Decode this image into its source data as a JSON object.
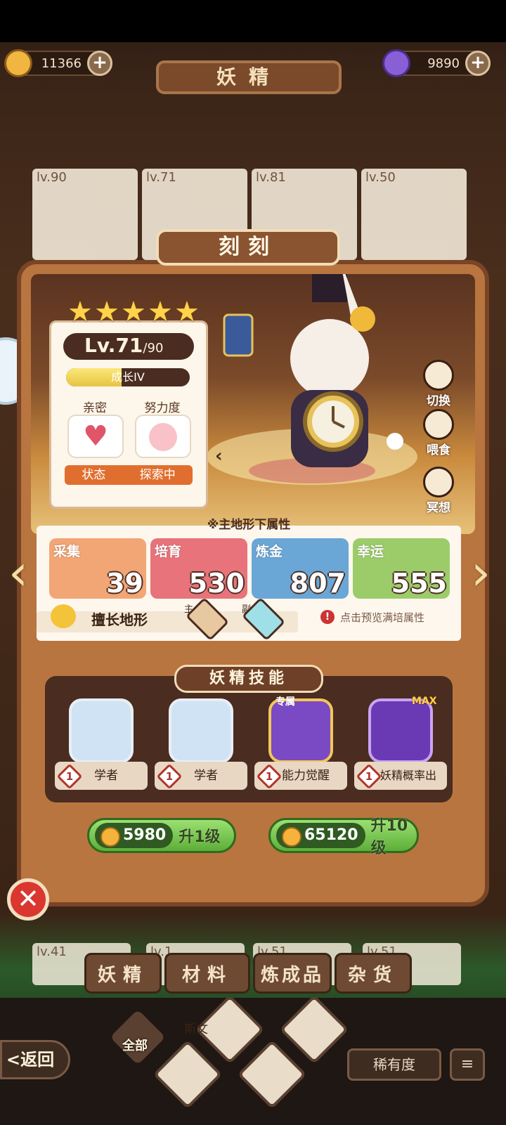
{
  "resources": {
    "gold": "11366",
    "gems": "9890"
  },
  "header": {
    "title": "妖精"
  },
  "background_cards": [
    {
      "level": "lv.90"
    },
    {
      "level": "lv.71"
    },
    {
      "level": "lv.81"
    },
    {
      "level": "lv.50"
    }
  ],
  "bottom_cards": [
    {
      "level": "lv.41"
    },
    {
      "level": "lv.1"
    },
    {
      "level": "lv.51"
    },
    {
      "level": "lv.51"
    }
  ],
  "fairy": {
    "name": "刻刻",
    "stars": 5,
    "level": "Lv.71",
    "max_level": "/90",
    "growth": "成长IV",
    "growth_progress": 0.45,
    "intimacy_label": "亲密",
    "effort_label": "努力度",
    "status_label": "状态",
    "status_value": "探索中"
  },
  "side_buttons": [
    {
      "label": "切换",
      "icon": "swap-icon"
    },
    {
      "label": "喂食",
      "icon": "meat-icon"
    },
    {
      "label": "冥想",
      "icon": "meditate-icon"
    }
  ],
  "attributes": {
    "title": "※主地形下属性",
    "items": [
      {
        "name": "采集",
        "value": "39",
        "color": "#f2a575"
      },
      {
        "name": "培育",
        "value": "530",
        "color": "#e8737a"
      },
      {
        "name": "炼金",
        "value": "807",
        "color": "#6aa6d6"
      },
      {
        "name": "幸运",
        "value": "555",
        "color": "#9ccc6a"
      }
    ],
    "terrain_label": "擅长地形",
    "main_tag": "主",
    "sub_tag": "副",
    "hint": "点击预览满培属性"
  },
  "skills": {
    "title": "妖精技能",
    "items": [
      {
        "name": "学者",
        "level": "1",
        "tag": ""
      },
      {
        "name": "学者",
        "level": "1",
        "tag": ""
      },
      {
        "name": "能力觉醒",
        "level": "1",
        "tag": "专属"
      },
      {
        "name": "妖精概率出",
        "level": "1",
        "tag": "MAX"
      }
    ]
  },
  "upgrade": [
    {
      "cost": "5980",
      "label": "升1级"
    },
    {
      "cost": "65120",
      "label": "升10级"
    }
  ],
  "tabs": [
    "妖精",
    "材料",
    "炼成品",
    "杂货"
  ],
  "bottom": {
    "back": "返回",
    "all": "全部",
    "rarity": "稀有度",
    "sort_icon": "list-sort-icon",
    "partial_name": "斯文"
  }
}
